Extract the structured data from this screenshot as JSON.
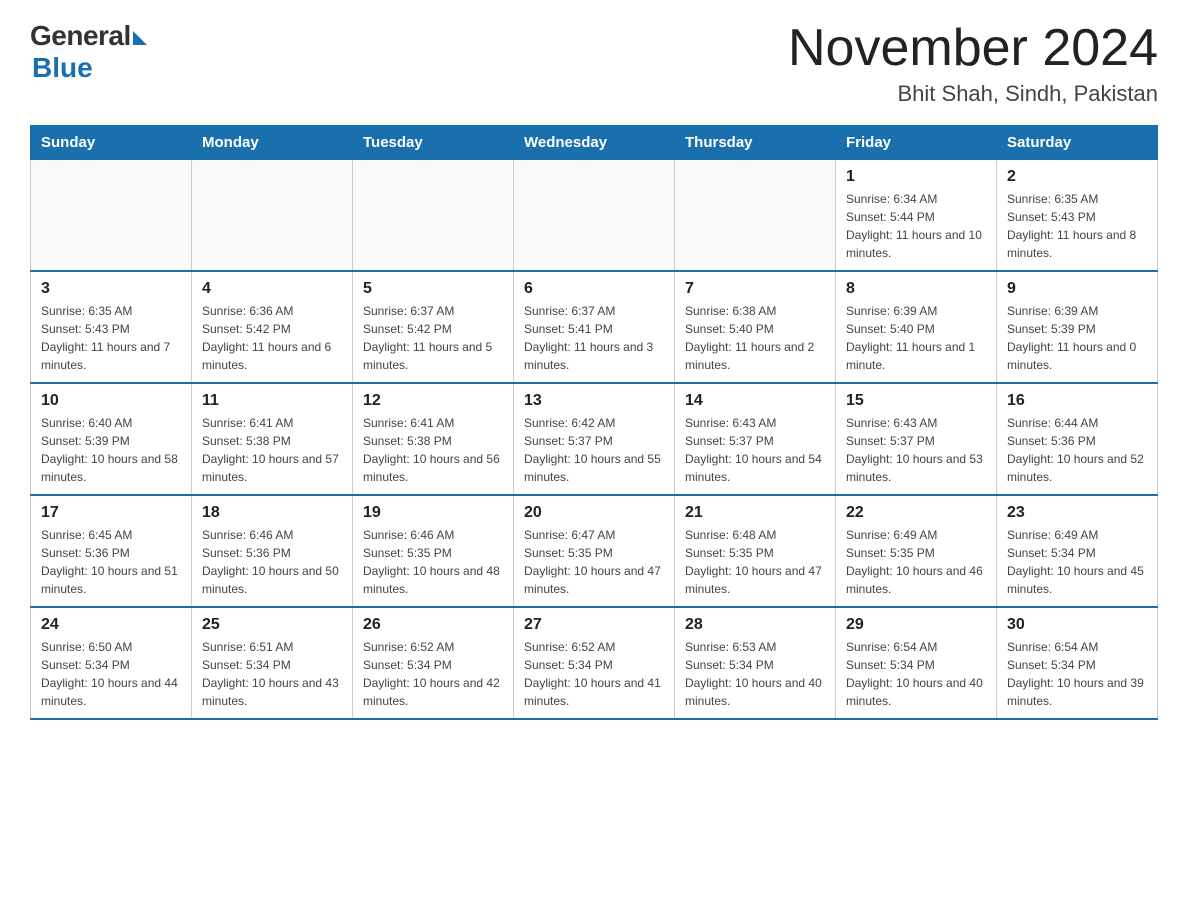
{
  "header": {
    "logo_general": "General",
    "logo_blue": "Blue",
    "month_year": "November 2024",
    "location": "Bhit Shah, Sindh, Pakistan"
  },
  "days_of_week": [
    "Sunday",
    "Monday",
    "Tuesday",
    "Wednesday",
    "Thursday",
    "Friday",
    "Saturday"
  ],
  "weeks": [
    [
      {
        "day": "",
        "info": ""
      },
      {
        "day": "",
        "info": ""
      },
      {
        "day": "",
        "info": ""
      },
      {
        "day": "",
        "info": ""
      },
      {
        "day": "",
        "info": ""
      },
      {
        "day": "1",
        "info": "Sunrise: 6:34 AM\nSunset: 5:44 PM\nDaylight: 11 hours and 10 minutes."
      },
      {
        "day": "2",
        "info": "Sunrise: 6:35 AM\nSunset: 5:43 PM\nDaylight: 11 hours and 8 minutes."
      }
    ],
    [
      {
        "day": "3",
        "info": "Sunrise: 6:35 AM\nSunset: 5:43 PM\nDaylight: 11 hours and 7 minutes."
      },
      {
        "day": "4",
        "info": "Sunrise: 6:36 AM\nSunset: 5:42 PM\nDaylight: 11 hours and 6 minutes."
      },
      {
        "day": "5",
        "info": "Sunrise: 6:37 AM\nSunset: 5:42 PM\nDaylight: 11 hours and 5 minutes."
      },
      {
        "day": "6",
        "info": "Sunrise: 6:37 AM\nSunset: 5:41 PM\nDaylight: 11 hours and 3 minutes."
      },
      {
        "day": "7",
        "info": "Sunrise: 6:38 AM\nSunset: 5:40 PM\nDaylight: 11 hours and 2 minutes."
      },
      {
        "day": "8",
        "info": "Sunrise: 6:39 AM\nSunset: 5:40 PM\nDaylight: 11 hours and 1 minute."
      },
      {
        "day": "9",
        "info": "Sunrise: 6:39 AM\nSunset: 5:39 PM\nDaylight: 11 hours and 0 minutes."
      }
    ],
    [
      {
        "day": "10",
        "info": "Sunrise: 6:40 AM\nSunset: 5:39 PM\nDaylight: 10 hours and 58 minutes."
      },
      {
        "day": "11",
        "info": "Sunrise: 6:41 AM\nSunset: 5:38 PM\nDaylight: 10 hours and 57 minutes."
      },
      {
        "day": "12",
        "info": "Sunrise: 6:41 AM\nSunset: 5:38 PM\nDaylight: 10 hours and 56 minutes."
      },
      {
        "day": "13",
        "info": "Sunrise: 6:42 AM\nSunset: 5:37 PM\nDaylight: 10 hours and 55 minutes."
      },
      {
        "day": "14",
        "info": "Sunrise: 6:43 AM\nSunset: 5:37 PM\nDaylight: 10 hours and 54 minutes."
      },
      {
        "day": "15",
        "info": "Sunrise: 6:43 AM\nSunset: 5:37 PM\nDaylight: 10 hours and 53 minutes."
      },
      {
        "day": "16",
        "info": "Sunrise: 6:44 AM\nSunset: 5:36 PM\nDaylight: 10 hours and 52 minutes."
      }
    ],
    [
      {
        "day": "17",
        "info": "Sunrise: 6:45 AM\nSunset: 5:36 PM\nDaylight: 10 hours and 51 minutes."
      },
      {
        "day": "18",
        "info": "Sunrise: 6:46 AM\nSunset: 5:36 PM\nDaylight: 10 hours and 50 minutes."
      },
      {
        "day": "19",
        "info": "Sunrise: 6:46 AM\nSunset: 5:35 PM\nDaylight: 10 hours and 48 minutes."
      },
      {
        "day": "20",
        "info": "Sunrise: 6:47 AM\nSunset: 5:35 PM\nDaylight: 10 hours and 47 minutes."
      },
      {
        "day": "21",
        "info": "Sunrise: 6:48 AM\nSunset: 5:35 PM\nDaylight: 10 hours and 47 minutes."
      },
      {
        "day": "22",
        "info": "Sunrise: 6:49 AM\nSunset: 5:35 PM\nDaylight: 10 hours and 46 minutes."
      },
      {
        "day": "23",
        "info": "Sunrise: 6:49 AM\nSunset: 5:34 PM\nDaylight: 10 hours and 45 minutes."
      }
    ],
    [
      {
        "day": "24",
        "info": "Sunrise: 6:50 AM\nSunset: 5:34 PM\nDaylight: 10 hours and 44 minutes."
      },
      {
        "day": "25",
        "info": "Sunrise: 6:51 AM\nSunset: 5:34 PM\nDaylight: 10 hours and 43 minutes."
      },
      {
        "day": "26",
        "info": "Sunrise: 6:52 AM\nSunset: 5:34 PM\nDaylight: 10 hours and 42 minutes."
      },
      {
        "day": "27",
        "info": "Sunrise: 6:52 AM\nSunset: 5:34 PM\nDaylight: 10 hours and 41 minutes."
      },
      {
        "day": "28",
        "info": "Sunrise: 6:53 AM\nSunset: 5:34 PM\nDaylight: 10 hours and 40 minutes."
      },
      {
        "day": "29",
        "info": "Sunrise: 6:54 AM\nSunset: 5:34 PM\nDaylight: 10 hours and 40 minutes."
      },
      {
        "day": "30",
        "info": "Sunrise: 6:54 AM\nSunset: 5:34 PM\nDaylight: 10 hours and 39 minutes."
      }
    ]
  ]
}
